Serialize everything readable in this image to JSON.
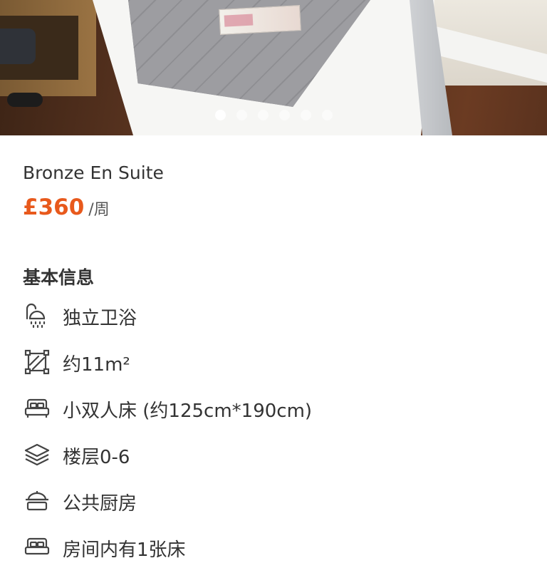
{
  "carousel": {
    "dot_count": 6,
    "active_index": 0
  },
  "room": {
    "title": "Bronze En Suite",
    "price": "£360",
    "price_unit": "/周"
  },
  "basic_info": {
    "section_title": "基本信息",
    "items": [
      {
        "icon": "shower-icon",
        "label": "独立卫浴"
      },
      {
        "icon": "area-icon",
        "label": "约11m²"
      },
      {
        "icon": "bed-icon",
        "label": "小双人床 (约125cm*190cm)"
      },
      {
        "icon": "layers-icon",
        "label": "楼层0-6"
      },
      {
        "icon": "kitchen-icon",
        "label": "公共厨房"
      },
      {
        "icon": "bed-icon",
        "label": "房间内有1张床"
      }
    ]
  },
  "colors": {
    "price": "#e8591c",
    "text": "#333333",
    "icon": "#444444"
  }
}
